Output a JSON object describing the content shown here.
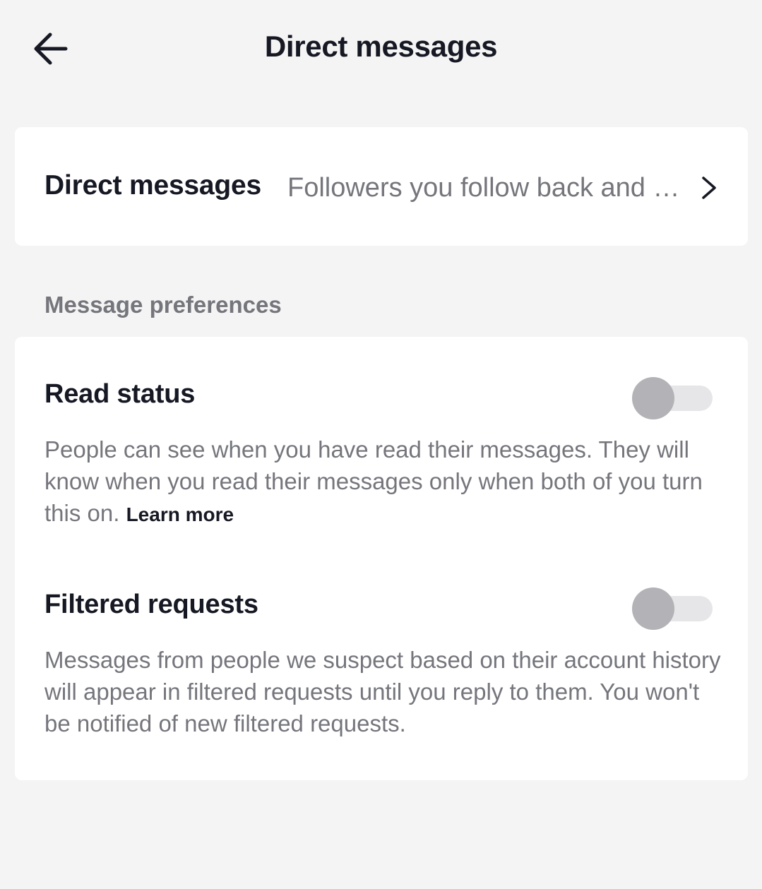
{
  "header": {
    "title": "Direct messages",
    "back_icon": "arrow-left-icon"
  },
  "dm_setting": {
    "label": "Direct messages",
    "value": "Followers you follow back and people you've sent messages to",
    "chevron_icon": "chevron-right-icon"
  },
  "preferences": {
    "section_label": "Message preferences",
    "read_status": {
      "title": "Read status",
      "description": "People can see when you have read their messages. They will know when you read their messages only when both of you turn this on.",
      "learn_more": "Learn more",
      "enabled": false
    },
    "filtered_requests": {
      "title": "Filtered requests",
      "description": "Messages from people we suspect based on their account history will appear in filtered requests until you reply to them. You won't be notified of new filtered requests.",
      "enabled": false
    }
  },
  "colors": {
    "background": "#f4f4f4",
    "card": "#ffffff",
    "primary_text": "#161823",
    "secondary_text": "#75767c",
    "toggle_track_off": "#e6e6e8",
    "toggle_knob_off": "#b2b2b7"
  }
}
